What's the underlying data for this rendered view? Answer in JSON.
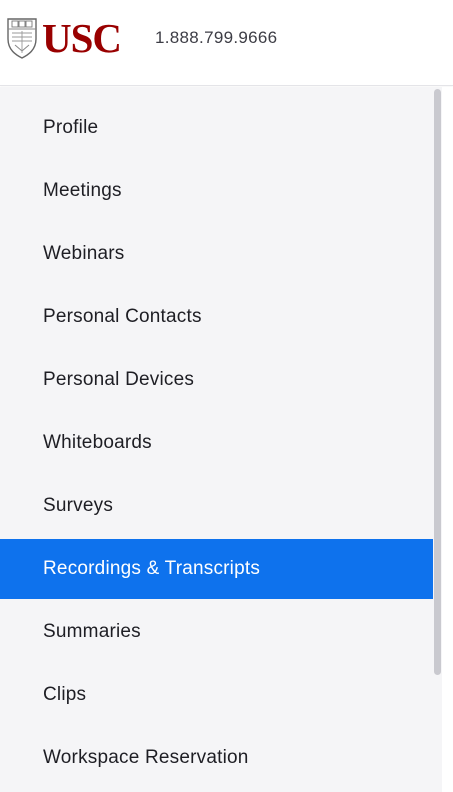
{
  "header": {
    "logo_text": "USC",
    "logo_color": "#990000",
    "phone": "1.888.799.9666"
  },
  "sidebar": {
    "active_color": "#0e72ed",
    "items": [
      {
        "label": "Profile"
      },
      {
        "label": "Meetings"
      },
      {
        "label": "Webinars"
      },
      {
        "label": "Personal Contacts"
      },
      {
        "label": "Personal Devices"
      },
      {
        "label": "Whiteboards"
      },
      {
        "label": "Surveys"
      },
      {
        "label": "Recordings & Transcripts",
        "active": true
      },
      {
        "label": "Summaries"
      },
      {
        "label": "Clips"
      },
      {
        "label": "Workspace Reservation"
      }
    ]
  }
}
